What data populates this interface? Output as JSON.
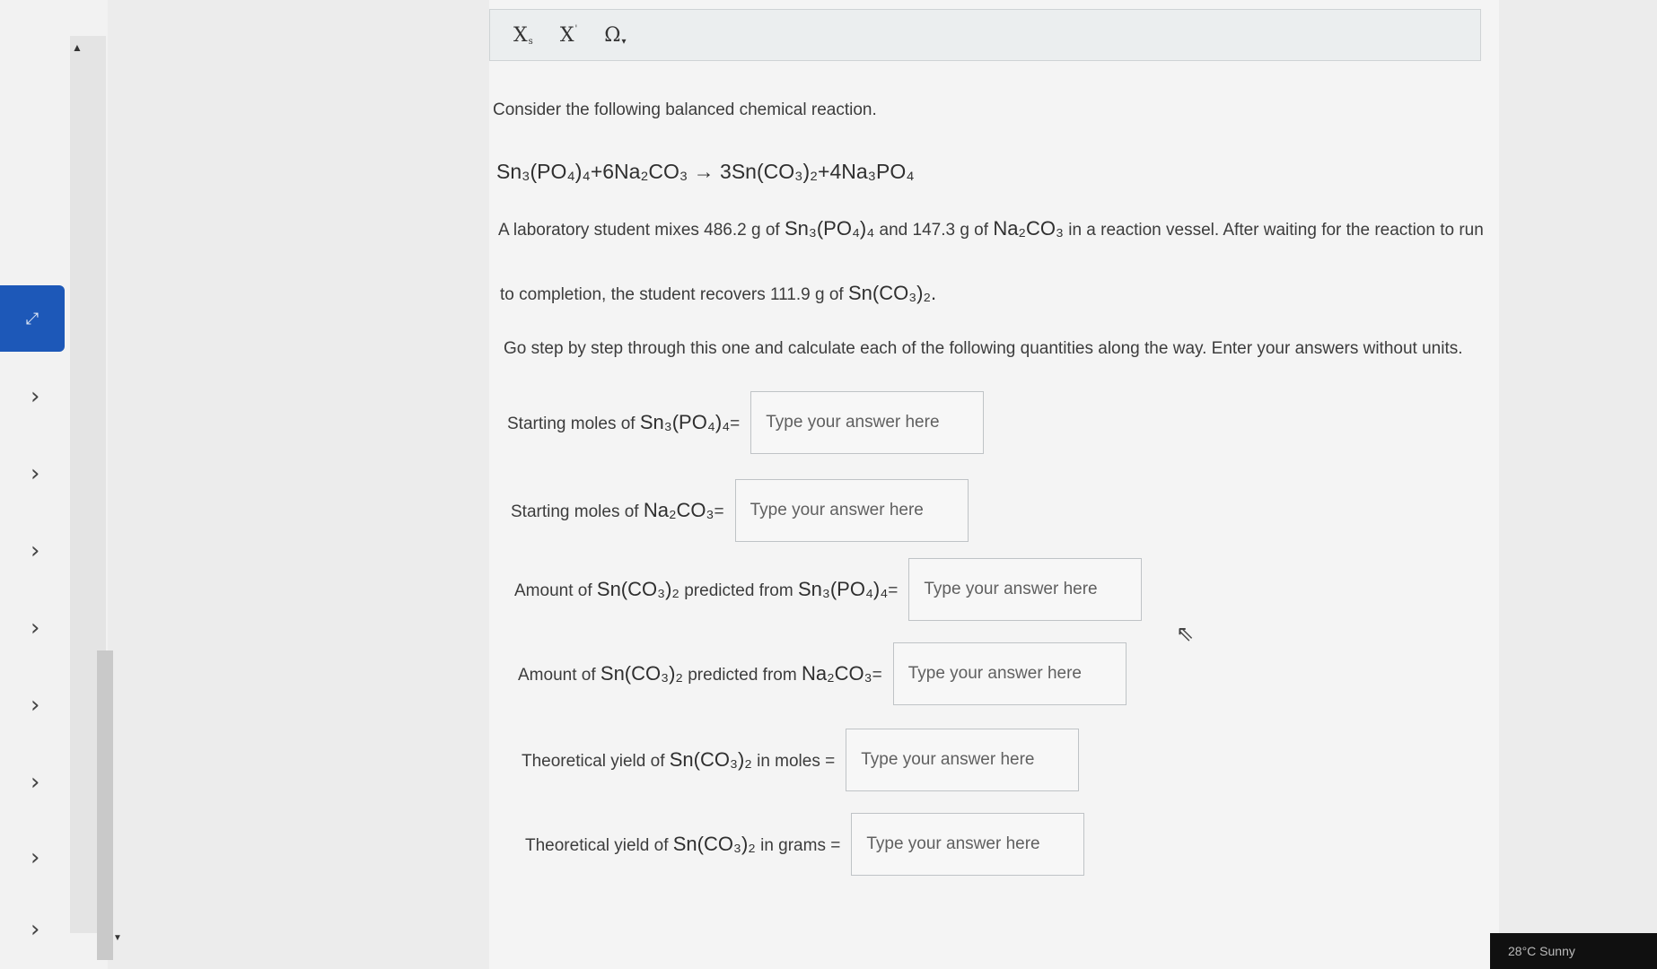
{
  "toolbar": {
    "subscript_label": "X",
    "subscript_mark": "s",
    "superscript_label": "X",
    "superscript_mark": "'",
    "omega_label": "Ω",
    "omega_dropdown": "▾"
  },
  "problem": {
    "intro": "Consider the following balanced chemical reaction.",
    "reaction": "Sn₃(PO₄)₄+6Na₂CO₃ → 3Sn(CO₃)₂+4Na₃PO₄",
    "sentence1_part1": "A laboratory student mixes 486.2 g of",
    "sentence1_chem1": "Sn₃(PO₄)₄",
    "sentence1_part2": "and 147.3 g of",
    "sentence1_chem2": "Na₂CO₃",
    "sentence1_part3": "in a reaction vessel. After waiting for the reaction to run",
    "sentence2_part1": "to completion, the student recovers 111.9 g of",
    "sentence2_chem": "Sn(CO₃)₂.",
    "instruction": "Go step by step through this one and calculate each of the following quantities along the way. Enter your answers without units."
  },
  "questions": [
    {
      "prefix": "Starting moles of",
      "chem": "Sn₃(PO₄)₄",
      "suffix": "=",
      "placeholder": "Type your answer here"
    },
    {
      "prefix": "Starting moles of",
      "chem": "Na₂CO₃",
      "suffix": "=",
      "placeholder": "Type your answer here"
    },
    {
      "prefix": "Amount of",
      "chem": "Sn(CO₃)₂",
      "suffix": "predicted from",
      "chem2": "Sn₃(PO₄)₄",
      "suffix2": "=",
      "placeholder": "Type your answer here"
    },
    {
      "prefix": "Amount of",
      "chem": "Sn(CO₃)₂",
      "suffix": "predicted from",
      "chem2": "Na₂CO₃",
      "suffix2": "=",
      "placeholder": "Type your answer here"
    },
    {
      "prefix": "Theoretical yield of",
      "chem": "Sn(CO₃)₂",
      "suffix": "in moles =",
      "placeholder": "Type your answer here"
    },
    {
      "prefix": "Theoretical yield of",
      "chem": "Sn(CO₃)₂",
      "suffix": "in grams =",
      "placeholder": "Type your answer here"
    }
  ],
  "taskbar": {
    "weather": "28°C Sunny"
  },
  "icons": {
    "expand": "expand-icon",
    "chevron": "chevron-right-icon",
    "cursor": "mouse-cursor-icon"
  }
}
